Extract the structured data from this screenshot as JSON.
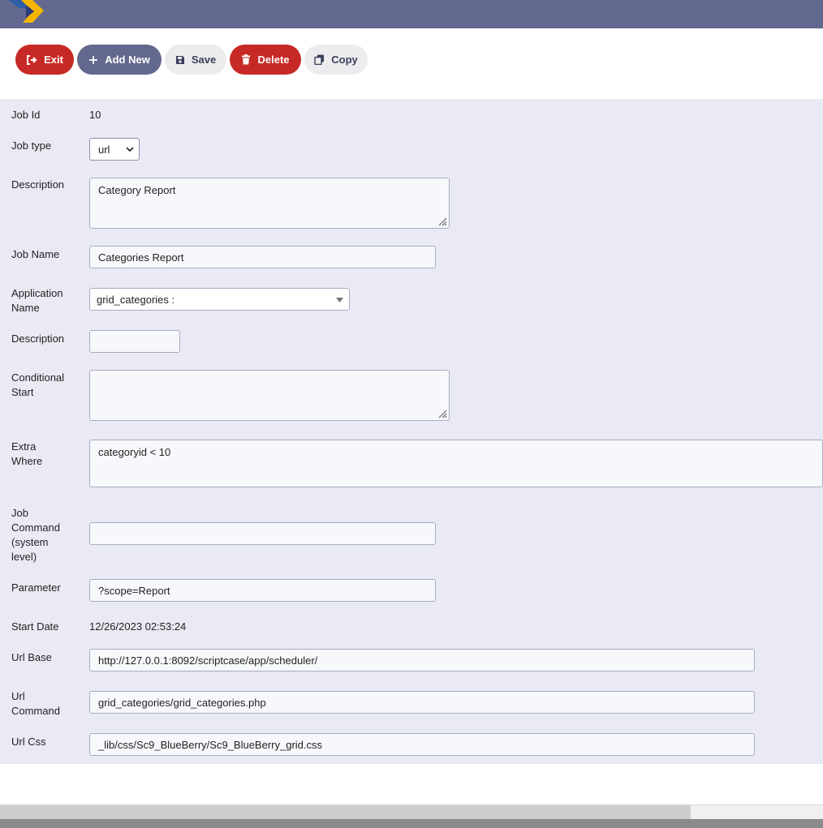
{
  "colors": {
    "header": "#63688f",
    "danger": "#c72a26",
    "form_bg": "#eaeaf4"
  },
  "toolbar": {
    "exit": {
      "label": "Exit",
      "icon": "exit-icon"
    },
    "add_new": {
      "label": "Add New",
      "icon": "plus-icon"
    },
    "save": {
      "label": "Save",
      "icon": "floppy-disk-icon"
    },
    "delete": {
      "label": "Delete",
      "icon": "trash-icon"
    },
    "copy": {
      "label": "Copy",
      "icon": "copy-icon"
    }
  },
  "form": {
    "job_id": {
      "label": "Job Id",
      "value": "10"
    },
    "job_type": {
      "label": "Job type",
      "value": "url"
    },
    "description": {
      "label": "Description",
      "value": "Category Report"
    },
    "job_name": {
      "label": "Job Name",
      "value": "Categories Report"
    },
    "application_name": {
      "label_line1": "Application",
      "label_line2": "Name",
      "value": "grid_categories :"
    },
    "description2": {
      "label": "Description",
      "value": ""
    },
    "conditional_start": {
      "label_line1": "Conditional",
      "label_line2": "Start",
      "value": ""
    },
    "extra_where": {
      "label_line1": "Extra",
      "label_line2": "Where",
      "value": "categoryid < 10"
    },
    "job_command": {
      "label_line1": "Job",
      "label_line2": "Command",
      "label_line3": "(system",
      "label_line4": "level)",
      "value": ""
    },
    "parameter": {
      "label": "Parameter",
      "value": "?scope=Report"
    },
    "start_date": {
      "label": "Start Date",
      "value": "12/26/2023 02:53:24"
    },
    "url_base": {
      "label": "Url Base",
      "value": "http://127.0.0.1:8092/scriptcase/app/scheduler/"
    },
    "url_command": {
      "label_line1": "Url",
      "label_line2": "Command",
      "value": "grid_categories/grid_categories.php"
    },
    "url_css": {
      "label": "Url Css",
      "value": "_lib/css/Sc9_BlueBerry/Sc9_BlueBerry_grid.css"
    }
  }
}
